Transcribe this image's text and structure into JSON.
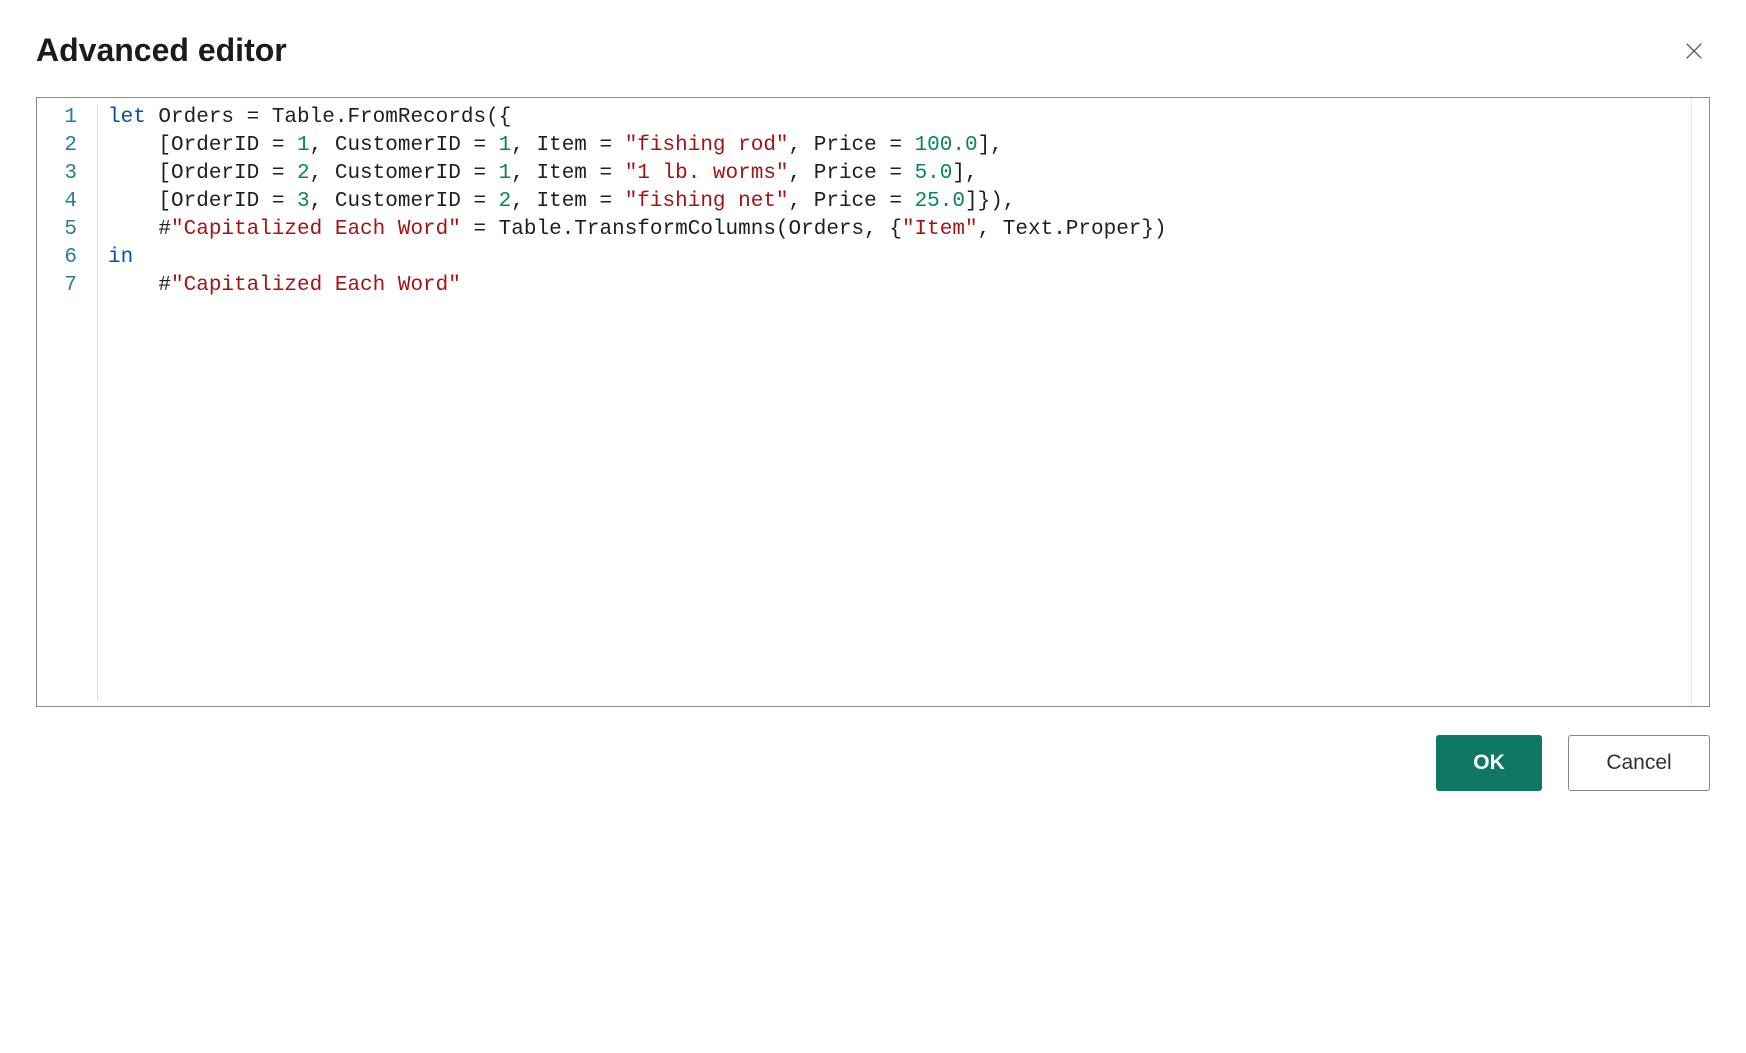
{
  "dialog": {
    "title": "Advanced editor"
  },
  "editor": {
    "line_numbers": [
      "1",
      "2",
      "3",
      "4",
      "5",
      "6",
      "7"
    ],
    "lines": [
      [
        {
          "t": "keyword",
          "v": "let"
        },
        {
          "t": "ident",
          "v": " Orders = Table.FromRecords({"
        }
      ],
      [
        {
          "t": "ident",
          "v": "    [OrderID = "
        },
        {
          "t": "number",
          "v": "1"
        },
        {
          "t": "ident",
          "v": ", CustomerID = "
        },
        {
          "t": "number",
          "v": "1"
        },
        {
          "t": "ident",
          "v": ", Item = "
        },
        {
          "t": "string",
          "v": "\"fishing rod\""
        },
        {
          "t": "ident",
          "v": ", Price = "
        },
        {
          "t": "number",
          "v": "100.0"
        },
        {
          "t": "ident",
          "v": "],"
        }
      ],
      [
        {
          "t": "ident",
          "v": "    [OrderID = "
        },
        {
          "t": "number",
          "v": "2"
        },
        {
          "t": "ident",
          "v": ", CustomerID = "
        },
        {
          "t": "number",
          "v": "1"
        },
        {
          "t": "ident",
          "v": ", Item = "
        },
        {
          "t": "string",
          "v": "\"1 lb. worms\""
        },
        {
          "t": "ident",
          "v": ", Price = "
        },
        {
          "t": "number",
          "v": "5.0"
        },
        {
          "t": "ident",
          "v": "],"
        }
      ],
      [
        {
          "t": "ident",
          "v": "    [OrderID = "
        },
        {
          "t": "number",
          "v": "3"
        },
        {
          "t": "ident",
          "v": ", CustomerID = "
        },
        {
          "t": "number",
          "v": "2"
        },
        {
          "t": "ident",
          "v": ", Item = "
        },
        {
          "t": "string",
          "v": "\"fishing net\""
        },
        {
          "t": "ident",
          "v": ", Price = "
        },
        {
          "t": "number",
          "v": "25.0"
        },
        {
          "t": "ident",
          "v": "]}),"
        }
      ],
      [
        {
          "t": "ident",
          "v": "    #"
        },
        {
          "t": "string",
          "v": "\"Capitalized Each Word\""
        },
        {
          "t": "ident",
          "v": " = Table.TransformColumns(Orders, {"
        },
        {
          "t": "string",
          "v": "\"Item\""
        },
        {
          "t": "ident",
          "v": ", Text.Proper})"
        }
      ],
      [
        {
          "t": "keyword",
          "v": "in"
        }
      ],
      [
        {
          "t": "ident",
          "v": "    #"
        },
        {
          "t": "string",
          "v": "\"Capitalized Each Word\""
        }
      ]
    ]
  },
  "buttons": {
    "ok": "OK",
    "cancel": "Cancel"
  }
}
